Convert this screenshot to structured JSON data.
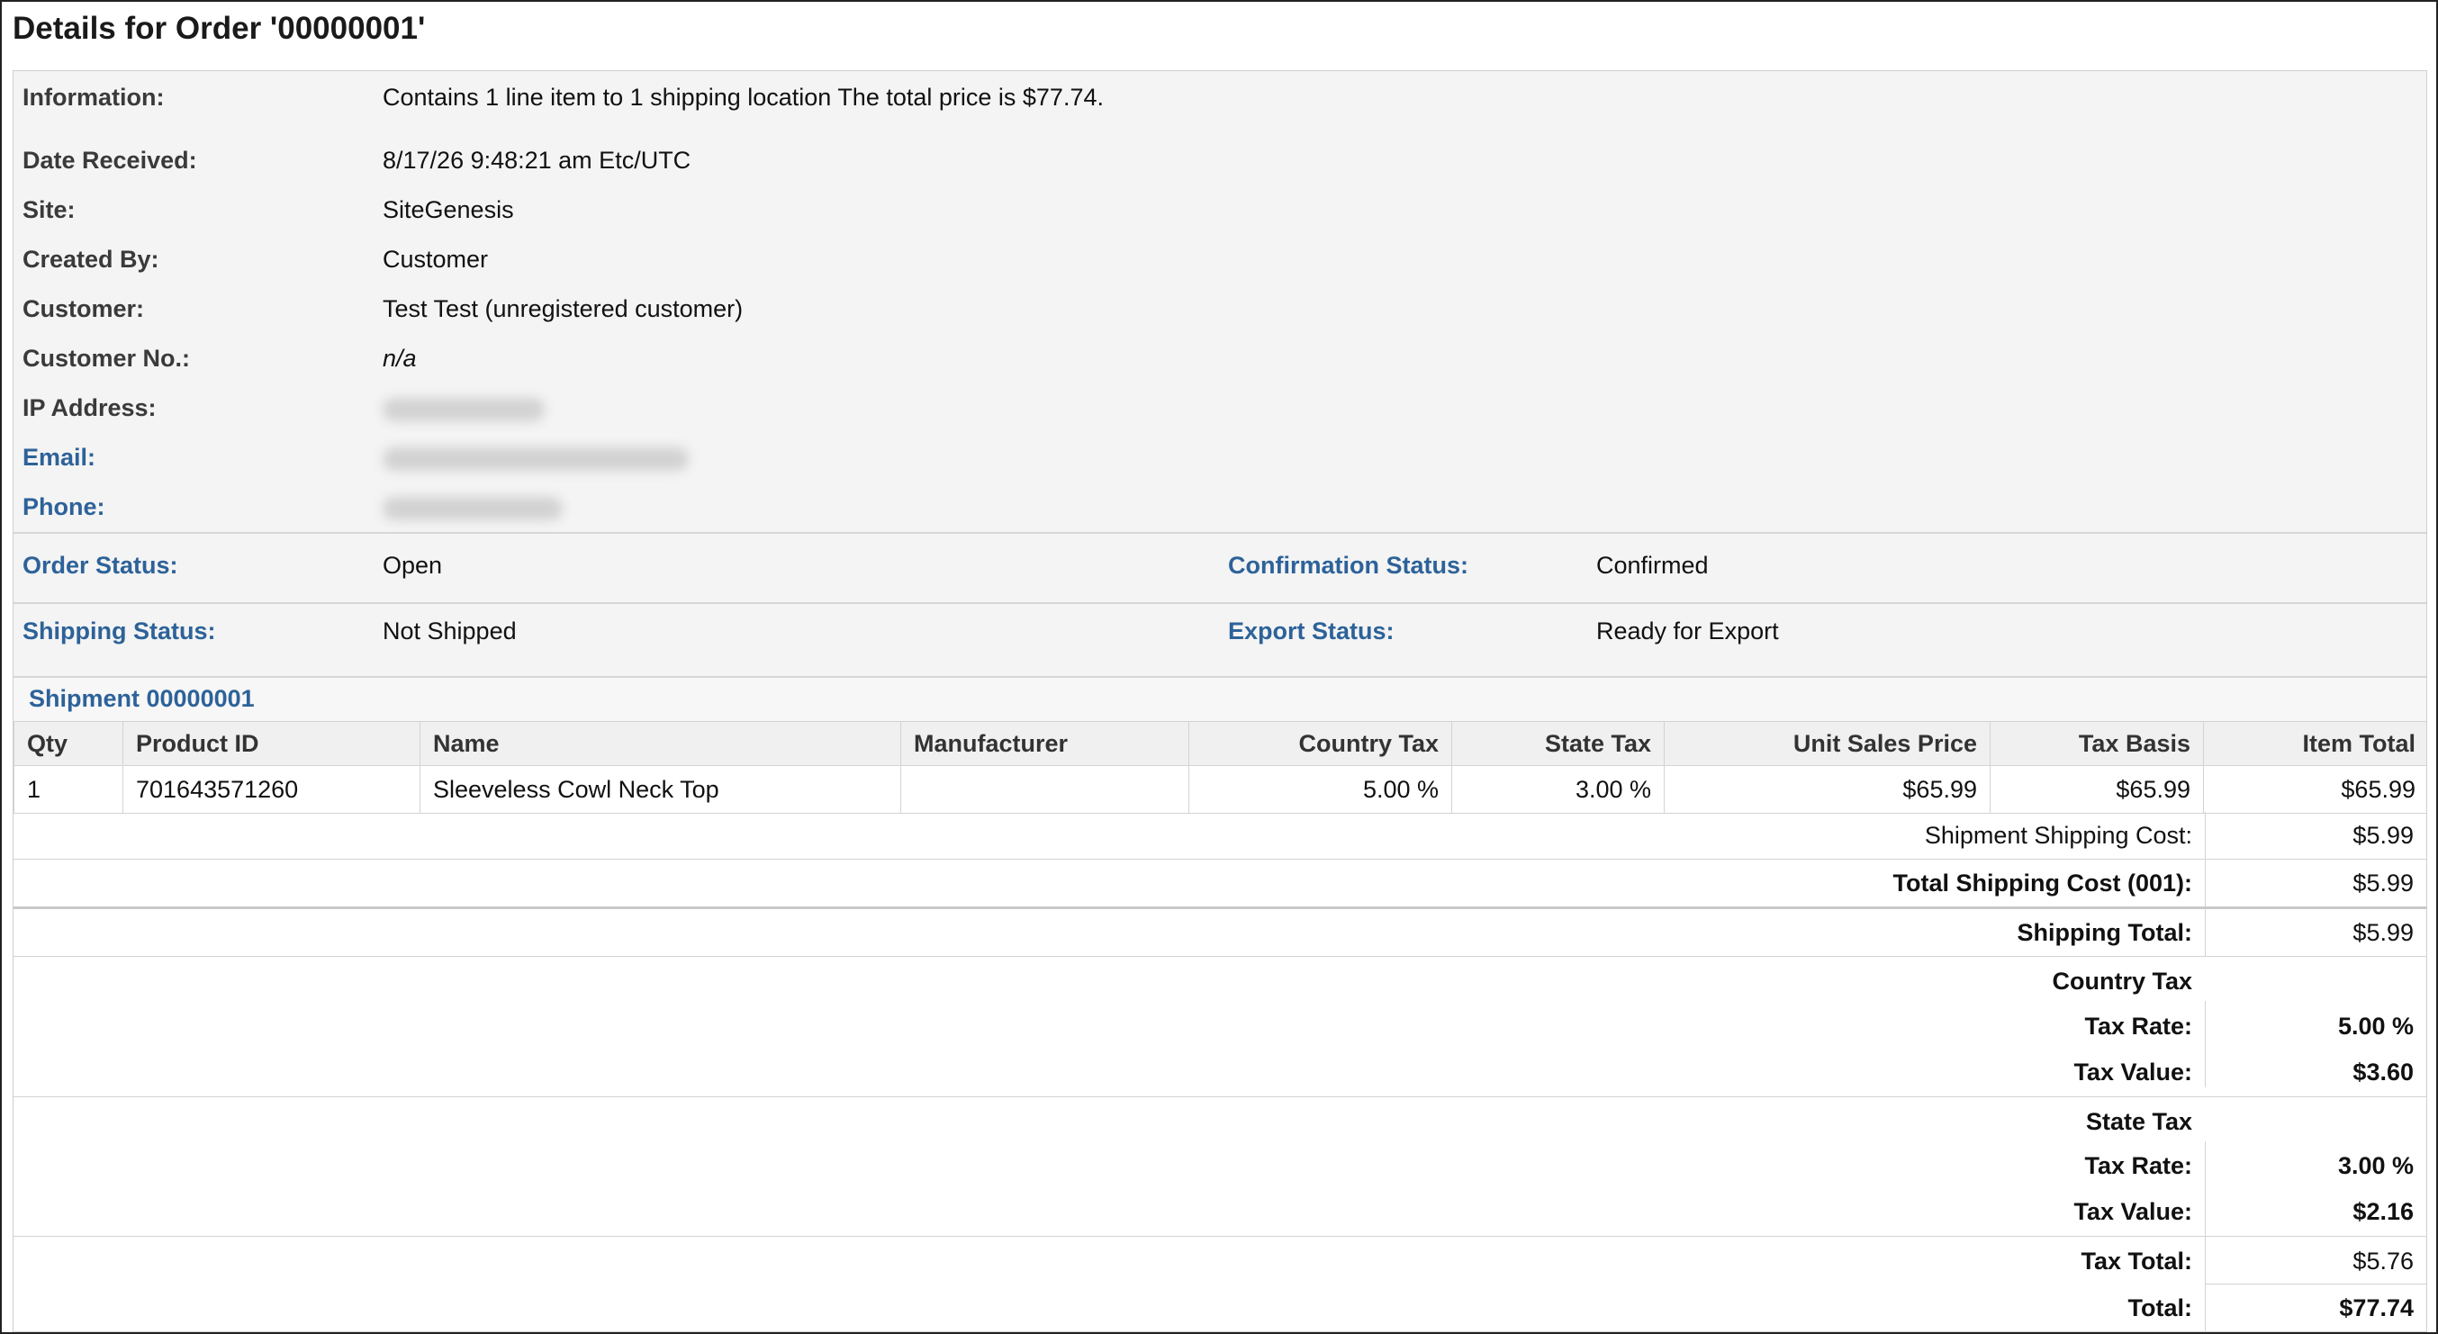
{
  "page": {
    "title": "Details for Order '00000001'"
  },
  "info": {
    "information_label": "Information:",
    "information_value": "Contains 1 line item to 1 shipping location The total price is $77.74.",
    "date_label": "Date Received:",
    "date_value": "8/17/26 9:48:21 am Etc/UTC",
    "site_label": "Site:",
    "site_value": "SiteGenesis",
    "created_label": "Created By:",
    "created_value": "Customer",
    "customer_label": "Customer:",
    "customer_value": "Test Test (unregistered customer)",
    "customer_no_label": "Customer No.:",
    "customer_no_value": "n/a",
    "ip_label": "IP Address:",
    "email_label": "Email:",
    "phone_label": "Phone:"
  },
  "status": {
    "order_label": "Order Status:",
    "order_value": "Open",
    "confirmation_label": "Confirmation Status:",
    "confirmation_value": "Confirmed",
    "shipping_label": "Shipping Status:",
    "shipping_value": "Not Shipped",
    "export_label": "Export Status:",
    "export_value": "Ready for Export"
  },
  "shipment": {
    "title": "Shipment 00000001",
    "columns": [
      "Qty",
      "Product ID",
      "Name",
      "Manufacturer",
      "Country Tax",
      "State Tax",
      "Unit Sales Price",
      "Tax Basis",
      "Item Total"
    ],
    "rows": [
      {
        "qty": "1",
        "product_id": "701643571260",
        "name": "Sleeveless Cowl Neck Top",
        "manufacturer": "",
        "country_tax": "5.00 %",
        "state_tax": "3.00 %",
        "unit_price": "$65.99",
        "tax_basis": "$65.99",
        "item_total": "$65.99"
      }
    ]
  },
  "totals": {
    "shipment_shipping_label": "Shipment Shipping Cost:",
    "shipment_shipping_value": "$5.99",
    "total_shipping_label": "Total Shipping Cost (001):",
    "total_shipping_value": "$5.99",
    "shipping_total_label": "Shipping Total:",
    "shipping_total_value": "$5.99",
    "country_tax_heading": "Country Tax",
    "country_rate_label": "Tax Rate:",
    "country_rate_value": "5.00 %",
    "country_value_label": "Tax Value:",
    "country_value_value": "$3.60",
    "state_tax_heading": "State Tax",
    "state_rate_label": "Tax Rate:",
    "state_rate_value": "3.00 %",
    "state_value_label": "Tax Value:",
    "state_value_value": "$2.16",
    "tax_total_label": "Tax Total:",
    "tax_total_value": "$5.76",
    "total_label": "Total:",
    "total_value": "$77.74"
  }
}
